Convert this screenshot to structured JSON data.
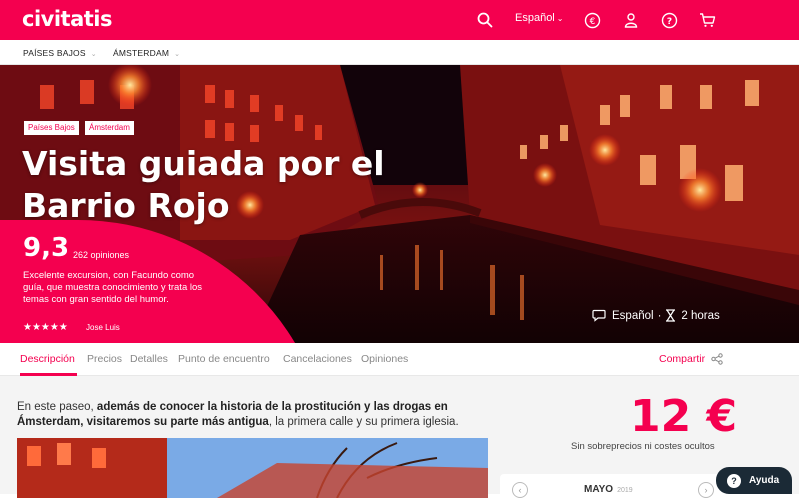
{
  "brand": {
    "logo": "civitatis",
    "accent": "#f4004f",
    "dark": "#1b2a36"
  },
  "header": {
    "language": "Español",
    "icons": [
      "search-icon",
      "euro-icon",
      "user-icon",
      "help-icon",
      "cart-icon"
    ]
  },
  "breadcrumbs": [
    {
      "label": "PAÍSES BAJOS"
    },
    {
      "label": "ÁMSTERDAM"
    }
  ],
  "hero": {
    "tags": [
      "Países Bajos",
      "Ámsterdam"
    ],
    "title": "Visita guiada por el Barrio Rojo",
    "score": "9,3",
    "reviews_count": "262 opiniones",
    "quote": "Excelente excursion, con Facundo como guía, que muestra conocimiento y trata los temas con gran sentido del humor.",
    "stars": "★★★★★",
    "reviewer": "Jose Luis",
    "language": "Español",
    "separator": "·",
    "duration": "2 horas"
  },
  "tabs": [
    {
      "label": "Descripción",
      "active": true
    },
    {
      "label": "Precios"
    },
    {
      "label": "Detalles"
    },
    {
      "label": "Punto de encuentro"
    },
    {
      "label": "Cancelaciones"
    },
    {
      "label": "Opiniones"
    }
  ],
  "share_label": "Compartir",
  "description": {
    "p1": "En este paseo, ",
    "b1": "además de conocer la historia de la prostitución y las drogas en Ámsterdam, visitaremos su parte más antigua",
    "p2": ", la primera calle y su primera iglesia."
  },
  "pricing": {
    "price": "12 €",
    "subtitle": "Sin sobreprecios ni costes ocultos"
  },
  "calendar": {
    "month": "MAYO",
    "year": "2019",
    "prev": "‹",
    "next": "›"
  },
  "help": {
    "label": "Ayuda"
  }
}
